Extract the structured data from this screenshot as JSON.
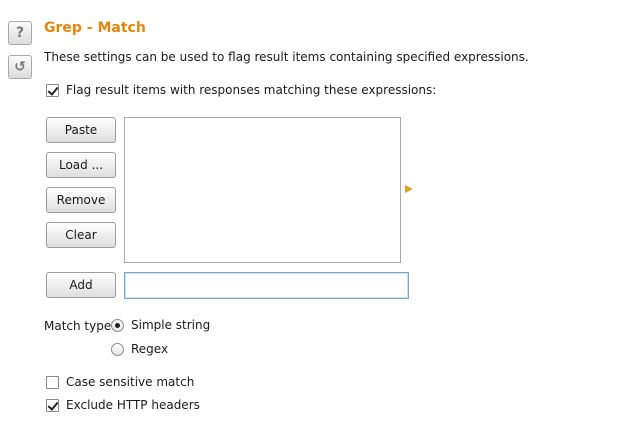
{
  "side_buttons": {
    "help_glyph": "?",
    "reset_glyph": "↺"
  },
  "section": {
    "title": "Grep - Match",
    "description": "These settings can be used to flag result items containing specified expressions."
  },
  "flag_checkbox": {
    "label": "Flag result items with responses matching these expressions:",
    "checked": true
  },
  "buttons": {
    "paste": "Paste",
    "load": "Load ...",
    "remove": "Remove",
    "clear": "Clear",
    "add": "Add"
  },
  "expressions": [],
  "add_input": {
    "value": "",
    "placeholder": ""
  },
  "match_type": {
    "label": "Match type:",
    "options": [
      {
        "label": "Simple string",
        "selected": true
      },
      {
        "label": "Regex",
        "selected": false
      }
    ]
  },
  "case_sensitive": {
    "label": "Case sensitive match",
    "checked": false
  },
  "exclude_headers": {
    "label": "Exclude HTTP headers",
    "checked": true
  },
  "colors": {
    "accent": "#e0880d",
    "arrow": "#e0a020",
    "input_border": "#7aa7c7"
  },
  "icons": {
    "help": "help-icon",
    "reset": "reset-icon",
    "expand": "expand-arrow-icon"
  }
}
